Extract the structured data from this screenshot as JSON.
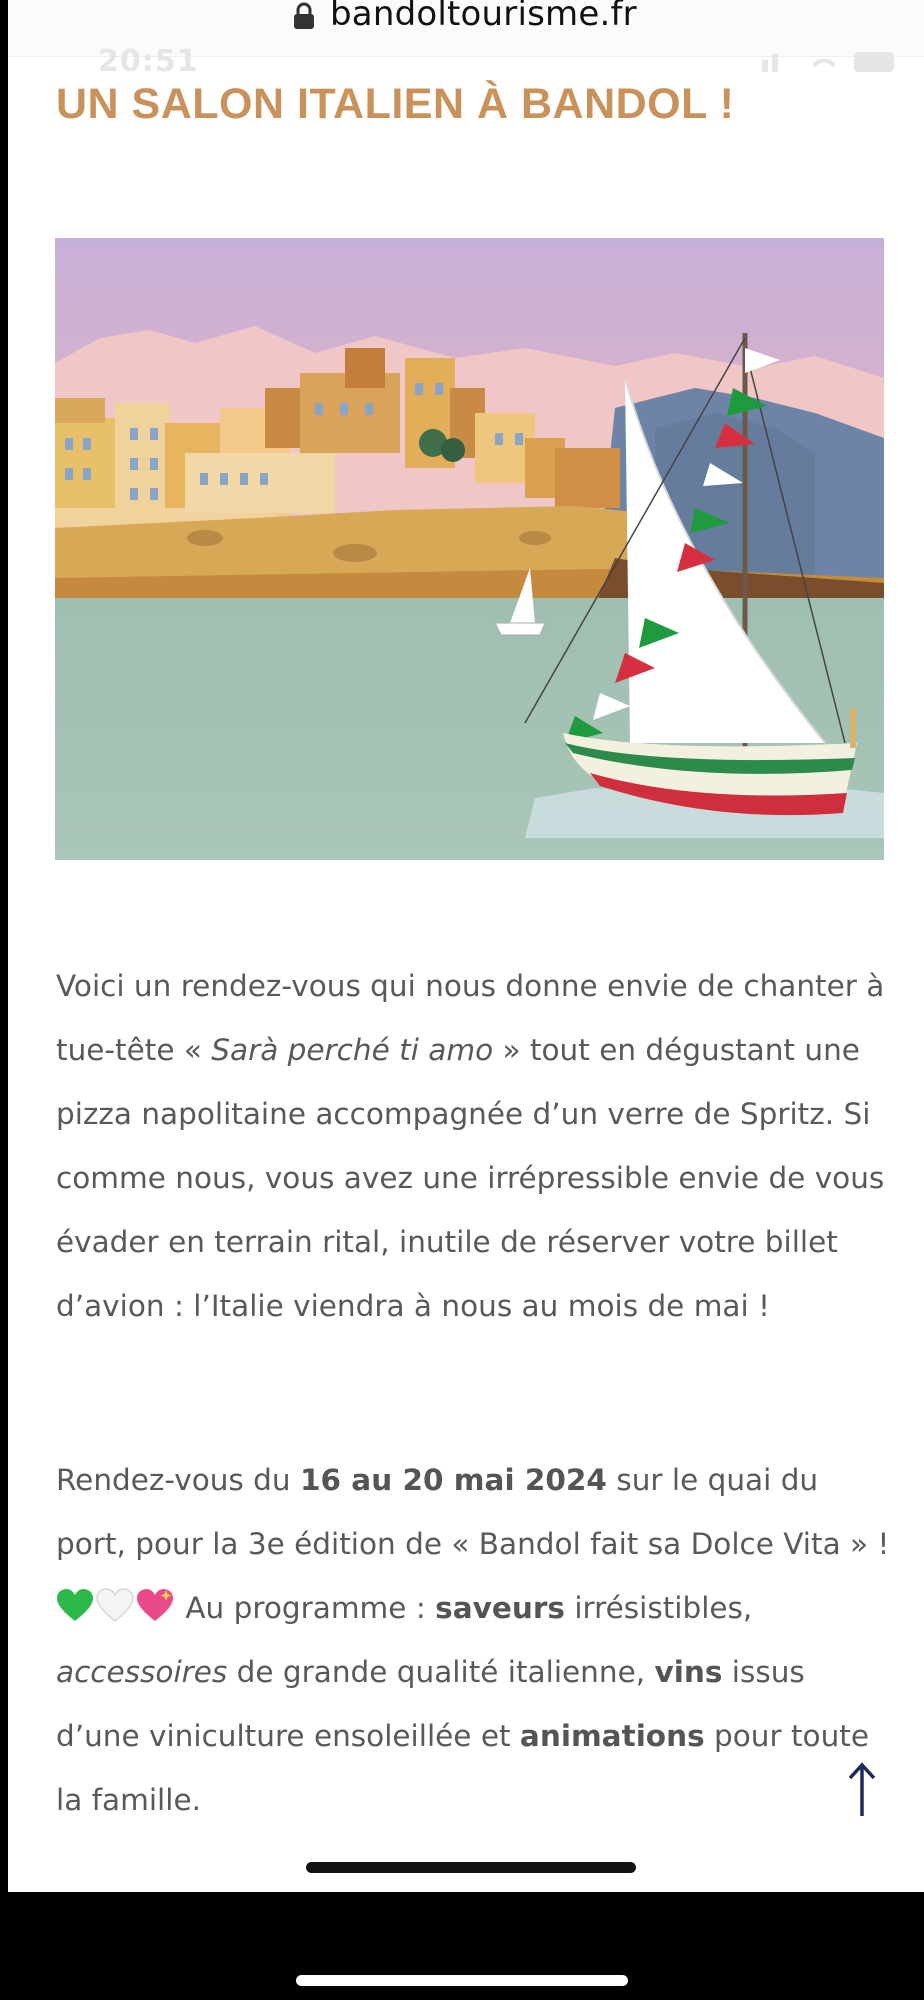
{
  "browser": {
    "url": "bandoltourisme.fr",
    "clock": "20:51"
  },
  "article": {
    "title": "UN SALON ITALIEN À BANDOL !",
    "paragraph1": {
      "p1": "Voici un rendez-vous qui nous donne envie de chanter à tue-tête « ",
      "song": "Sarà perché ti amo",
      "p2": " » tout en dégustant une pizza napolitaine accompagnée d’un verre de Spritz. Si comme nous, vous avez une irrépressible envie de vous évader en terrain rital, inutile de réserver votre billet d’avion : l’Italie viendra à nous au mois de mai !"
    },
    "paragraph2": {
      "p1": "Rendez-vous du ",
      "dates": "16 au 20 mai 2024",
      "p2": " sur le quai du port, pour la 3e édition de « Bandol fait sa Dolce Vita » ! ",
      "p3": " Au programme : ",
      "saveurs": "saveurs",
      "p4": " irrésistibles, ",
      "accessoires": "accessoires",
      "p5": " de grande qualité italienne, ",
      "vins": "vins",
      "p6": " issus d’une viniculture ensoleillée et ",
      "animations": "animations",
      "p7": " pour toute la famille."
    }
  },
  "colors": {
    "title": "#c9925a",
    "body_text": "#595959",
    "flag_green": "#1f9a3e",
    "flag_red": "#d63040"
  },
  "icons": {
    "lock": "lock-icon",
    "scroll_top": "arrow-up-icon",
    "hearts": [
      "green-heart-icon",
      "white-heart-icon",
      "sparkling-heart-icon"
    ]
  }
}
